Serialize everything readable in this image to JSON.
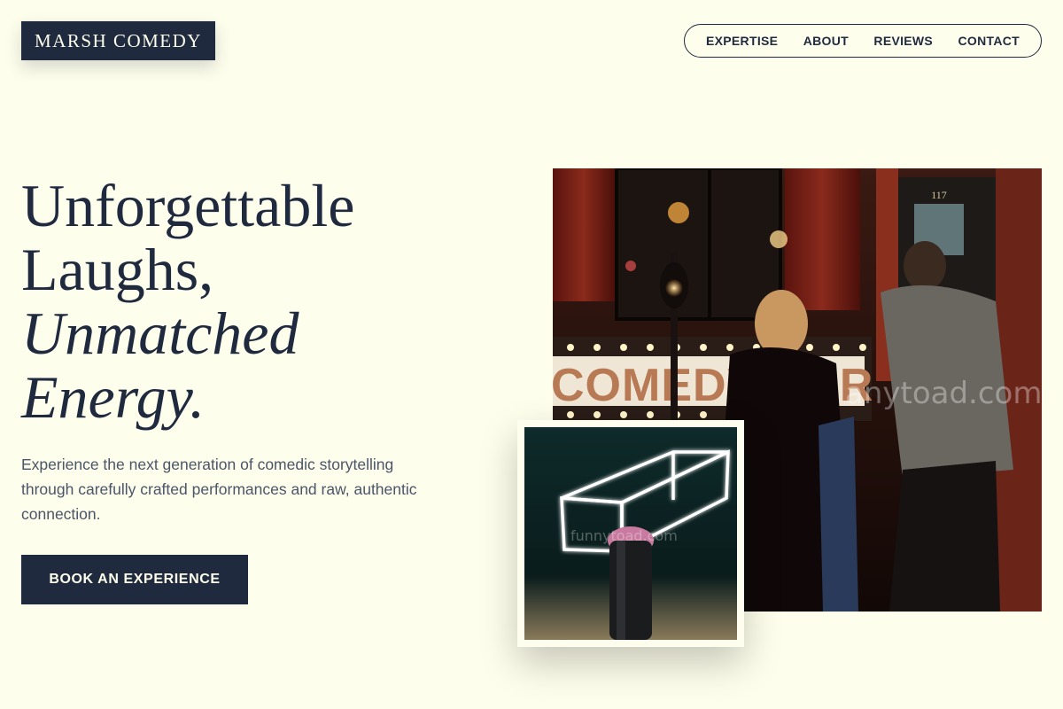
{
  "brand": {
    "logo_text": "MARSH COMEDY"
  },
  "nav": {
    "items": [
      {
        "label": "EXPERTISE"
      },
      {
        "label": "ABOUT"
      },
      {
        "label": "REVIEWS"
      },
      {
        "label": "CONTACT"
      }
    ]
  },
  "hero": {
    "headline_line1": "Unforgettable",
    "headline_line2": "Laughs,",
    "headline_line3": "Unmatched",
    "headline_line4": "Energy.",
    "subtext": "Experience the next generation of comedic storytelling through carefully crafted performances and raw, authentic connection.",
    "cta_label": "BOOK AN EXPERIENCE"
  },
  "images": {
    "main_photo": {
      "marquee_text": "COMEDY BAR",
      "door_number": "117",
      "watermark": "anytoad.com"
    },
    "small_photo": {
      "watermark": "funnytoad.com"
    }
  },
  "colors": {
    "background": "#fefeec",
    "navy": "#1f2a3f",
    "body_text": "#4b5568"
  }
}
